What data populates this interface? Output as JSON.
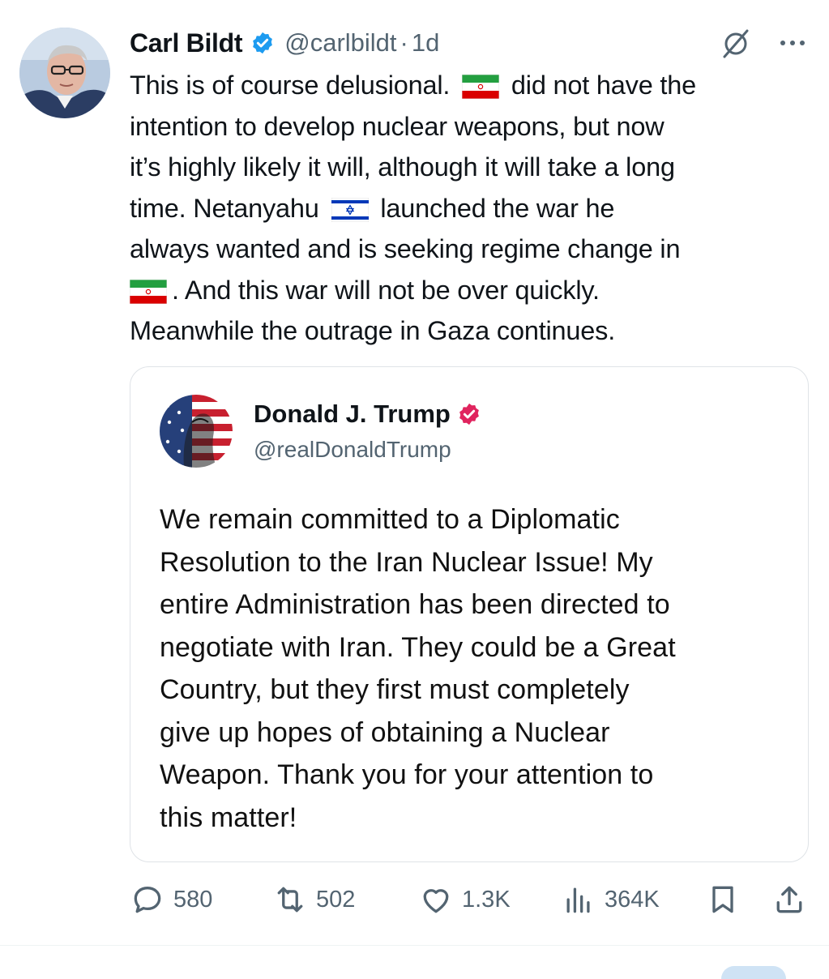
{
  "tweet": {
    "author_name": "Carl Bildt",
    "handle": "@carlbildt",
    "separator": "·",
    "time": "1d",
    "lines": [
      [
        "This is of course delusional.",
        "did not have the"
      ],
      [
        "intention to develop nuclear weapons, but now"
      ],
      [
        "it’s highly likely it will, although it will take a long"
      ],
      [
        "time. Netanyahu",
        "launched the war he"
      ],
      [
        "always wanted and is seeking regime change in"
      ],
      [
        "",
        ". And this war will not be over quickly."
      ],
      [
        "Meanwhile the outrage in Gaza continues."
      ]
    ],
    "flags": [
      "iran-flag",
      "israel-flag",
      "iran-flag"
    ]
  },
  "quote": {
    "author_name": "Donald J. Trump",
    "handle": "@realDonaldTrump",
    "lines": [
      "We remain committed to a Diplomatic",
      "Resolution to the Iran Nuclear Issue! My",
      "entire Administration has been directed to",
      "negotiate with Iran. They could be a Great",
      "Country, but they first must completely",
      "give up hopes of obtaining a Nuclear",
      "Weapon. Thank you for your attention to",
      "this matter!"
    ]
  },
  "actions": {
    "replies": "580",
    "reposts": "502",
    "likes": "1.3K",
    "views": "364K"
  },
  "colors": {
    "verified_blue": "#1d9bf0",
    "verified_red": "#e0245e",
    "muted_text": "#536471",
    "border": "#dfe3e7"
  },
  "icons": [
    "verified-badge-icon",
    "grok-icon",
    "more-icon",
    "reply-icon",
    "repost-icon",
    "like-icon",
    "views-icon",
    "bookmark-icon",
    "share-icon"
  ]
}
